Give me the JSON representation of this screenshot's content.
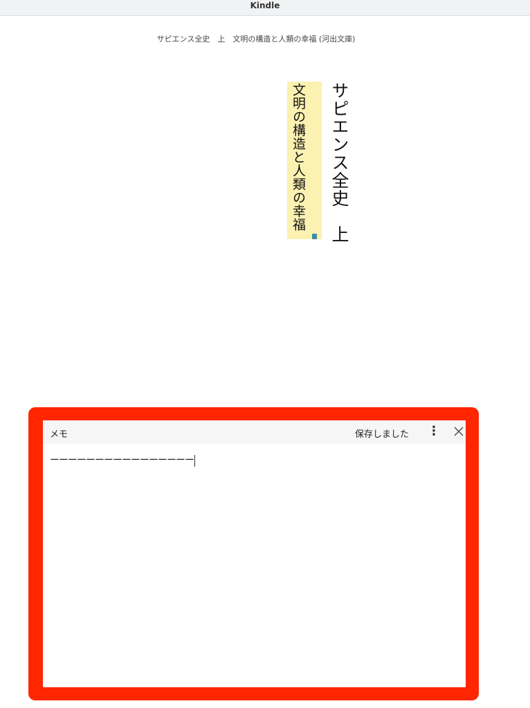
{
  "window": {
    "title": "Kindle"
  },
  "book": {
    "header": "サピエンス全史　上　文明の構造と人類の幸福 (河出文庫)",
    "title": "サピエンス全史　上",
    "subtitle": "文明の構造と人類の幸福",
    "highlight_color": "#fbf1b1",
    "note_marker_icon": "note-icon"
  },
  "memo": {
    "title": "メモ",
    "status": "保存しました",
    "menu_icon": "more-vertical-icon",
    "close_icon": "close-icon",
    "content": "ーーーーーーーーーーーーーーーー",
    "frame_color": "#ff2600"
  }
}
